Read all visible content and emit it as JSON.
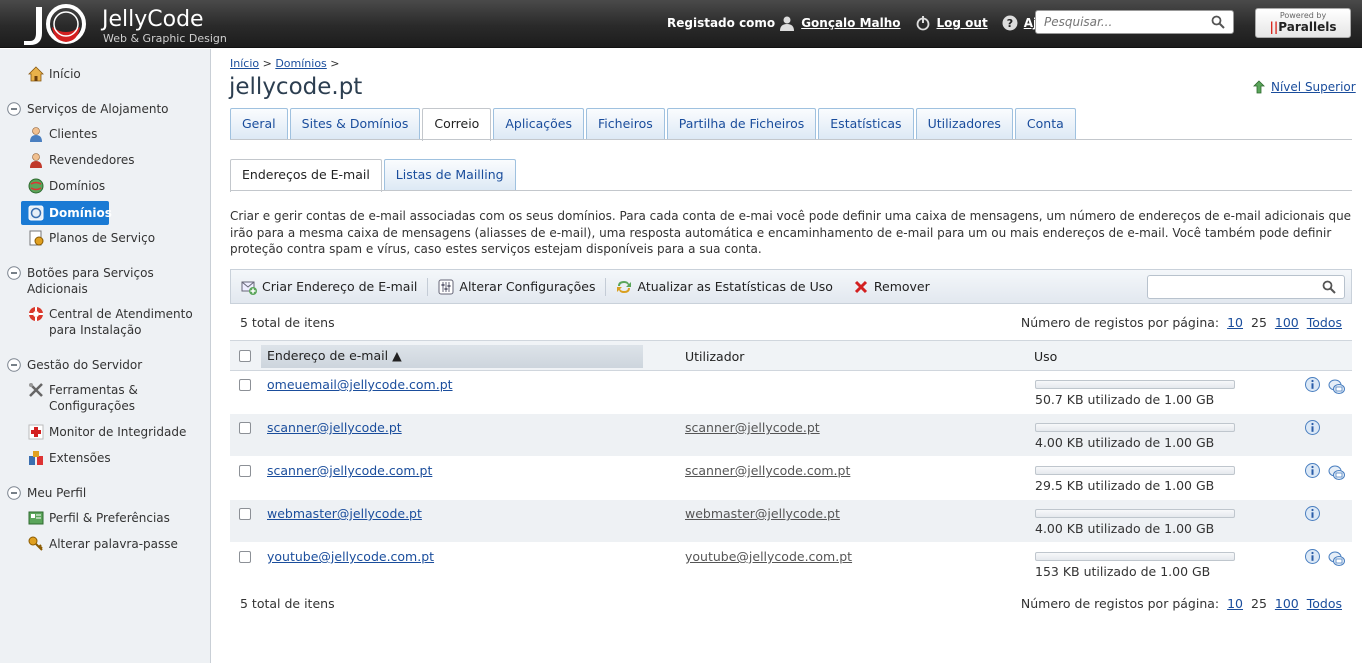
{
  "header": {
    "brand": "JellyCode",
    "tagline": "Web & Graphic Design",
    "registered_as": "Registado como",
    "user": "Gonçalo Malho",
    "logout": "Log out",
    "help": "Ajuda",
    "search_placeholder": "Pesquisar...",
    "powered_by": "Powered by",
    "parallels": "Parallels"
  },
  "sidebar": {
    "home": "Início",
    "sections": [
      {
        "label": "Serviços de Alojamento",
        "items": [
          "Clientes",
          "Revendedores",
          "Domínios",
          "Domínios",
          "Planos de Serviço"
        ]
      },
      {
        "label": "Botões para Serviços Adicionais",
        "items": [
          "Central de Atendimento para Instalação"
        ]
      },
      {
        "label": "Gestão do Servidor",
        "items": [
          "Ferramentas & Configurações",
          "Monitor de Integridade",
          "Extensões"
        ]
      },
      {
        "label": "Meu Perfil",
        "items": [
          "Perfil & Preferências",
          "Alterar palavra-passe"
        ]
      }
    ]
  },
  "breadcrumb": [
    "Início",
    "Domínios"
  ],
  "page_title": "jellycode.pt",
  "up_level": "Nível Superior",
  "tabs": [
    "Geral",
    "Sites & Domínios",
    "Correio",
    "Aplicações",
    "Ficheiros",
    "Partilha de Ficheiros",
    "Estatísticas",
    "Utilizadores",
    "Conta"
  ],
  "active_tab": "Correio",
  "subtabs": [
    "Endereços de E-mail",
    "Listas de Mailling"
  ],
  "description": "Criar e gerir contas de e-mail associadas com os seus domínios. Para cada conta de e-mai você pode definir uma caixa de mensagens, um número de endereços de e-mail adicionais que irão para a mesma caixa de mensagens (aliasses de e-mail), uma resposta automática e encaminhamento de e-mail para um ou mais endereços de e-mail. Você também pode definir proteção contra spam e vírus, caso estes serviços estejam disponíveis para a sua conta.",
  "toolbar": {
    "create": "Criar Endereço de E-mail",
    "settings": "Alterar Configurações",
    "refresh": "Atualizar as Estatísticas de Uso",
    "remove": "Remover"
  },
  "list": {
    "total": "5 total de itens",
    "per_page_label": "Número de registos por página:",
    "per_page_options": [
      "10",
      "25",
      "100",
      "Todos"
    ],
    "per_page_current": "25",
    "columns": {
      "email": "Endereço de e-mail",
      "user": "Utilizador",
      "usage": "Uso"
    },
    "rows": [
      {
        "email": "omeuemail@jellycode.com.pt",
        "user": "",
        "usage": "50.7 KB utilizado de 1.00 GB",
        "fraction": 5e-05,
        "mailbox_icon": true
      },
      {
        "email": "scanner@jellycode.pt",
        "user": "scanner@jellycode.pt",
        "usage": "4.00 KB utilizado de 1.00 GB",
        "fraction": 4e-06,
        "mailbox_icon": false
      },
      {
        "email": "scanner@jellycode.com.pt",
        "user": "scanner@jellycode.com.pt",
        "usage": "29.5 KB utilizado de 1.00 GB",
        "fraction": 3e-05,
        "mailbox_icon": true
      },
      {
        "email": "webmaster@jellycode.pt",
        "user": "webmaster@jellycode.pt",
        "usage": "4.00 KB utilizado de 1.00 GB",
        "fraction": 4e-06,
        "mailbox_icon": false
      },
      {
        "email": "youtube@jellycode.com.pt",
        "user": "youtube@jellycode.com.pt",
        "usage": "153 KB utilizado de 1.00 GB",
        "fraction": 0.00015,
        "mailbox_icon": true
      }
    ]
  },
  "colors": {
    "accent": "#1a7ad4",
    "link": "#1a4d9c",
    "topbar": "#2a2a2a"
  }
}
